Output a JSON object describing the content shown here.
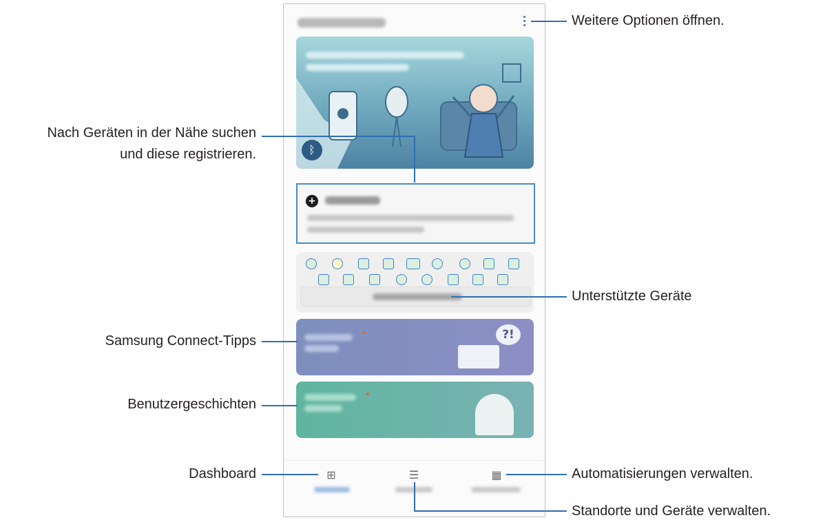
{
  "callouts": {
    "more_options": "Weitere Optionen öffnen.",
    "scan_line1": "Nach Geräten in der Nähe suchen",
    "scan_line2": "und diese registrieren.",
    "supported": "Unterstützte Geräte",
    "tips": "Samsung Connect-Tipps",
    "stories": "Benutzergeschichten",
    "dashboard": "Dashboard",
    "automations": "Automatisierungen verwalten.",
    "locations": "Standorte und Geräte verwalten."
  },
  "icons": {
    "more": "more-vertical-icon",
    "bluetooth": "bluetooth-icon",
    "add": "plus-circle-icon",
    "dashboard": "dashboard-icon",
    "devices": "device-list-icon",
    "automation": "automation-icon"
  },
  "hero_glyphs": {
    "bluetooth": "ᛒ",
    "plus": "+"
  },
  "tips_glyph": "?!",
  "nav_glyphs": {
    "dashboard": "⊞",
    "devices": "☰",
    "automation": "▦"
  },
  "colors": {
    "callout_line": "#2f6eb0",
    "highlight": "#4a8ac6",
    "accent_dot": "#e7622f"
  }
}
